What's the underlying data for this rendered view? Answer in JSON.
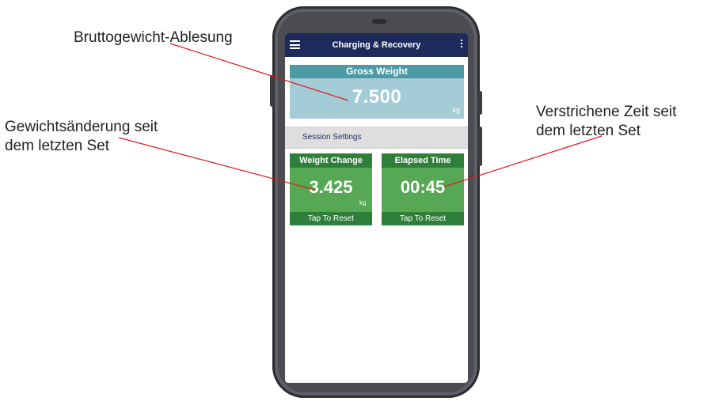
{
  "callouts": {
    "gross": "Bruttogewicht-Ablesung",
    "change_line1": "Gewichtsänderung seit",
    "change_line2": "dem letzten Set",
    "elapsed_line1": "Verstrichene Zeit seit",
    "elapsed_line2": "dem letzten Set"
  },
  "app": {
    "title": "Charging & Recovery",
    "menu_icon": "hamburger-menu-icon",
    "more_icon": "more-vertical-icon"
  },
  "gross": {
    "label": "Gross Weight",
    "value": "7.500",
    "unit": "kg"
  },
  "settings": {
    "label": "Session Settings"
  },
  "weight_change": {
    "label": "Weight Change",
    "value": "3.425",
    "unit": "kg",
    "action": "Tap To Reset"
  },
  "elapsed": {
    "label": "Elapsed Time",
    "value": "00:45",
    "action": "Tap To Reset"
  },
  "colors": {
    "app_bar": "#1d2b5c",
    "gross_header": "#4b9aa6",
    "gross_body": "#a4ccd7",
    "tile_dark": "#2f7f3a",
    "tile_body": "#56a854",
    "leader_line": "#e01a1a"
  }
}
